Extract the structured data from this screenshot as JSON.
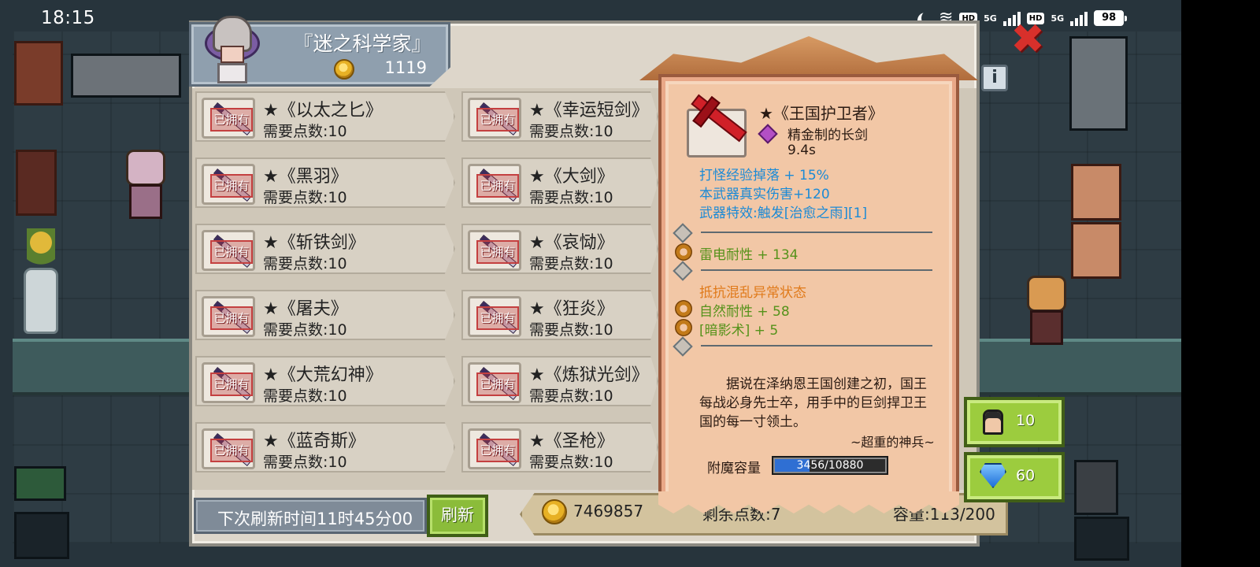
{
  "status_bar": {
    "time": "18:15",
    "hd1": "HD",
    "net1": "5G",
    "hd2": "HD",
    "net2": "5G",
    "battery": "98"
  },
  "header": {
    "merchant_name": "『迷之科学家』",
    "gold": "1119"
  },
  "owned_label": "已拥有",
  "items": [
    {
      "name": "★《以太之匕》",
      "cost": "需要点数:10"
    },
    {
      "name": "★《幸运短剑》",
      "cost": "需要点数:10"
    },
    {
      "name": "★《黑羽》",
      "cost": "需要点数:10"
    },
    {
      "name": "★《大剑》",
      "cost": "需要点数:10"
    },
    {
      "name": "★《斩铁剑》",
      "cost": "需要点数:10"
    },
    {
      "name": "★《哀恸》",
      "cost": "需要点数:10"
    },
    {
      "name": "★《屠夫》",
      "cost": "需要点数:10"
    },
    {
      "name": "★《狂炎》",
      "cost": "需要点数:10"
    },
    {
      "name": "★《大荒幻神》",
      "cost": "需要点数:10"
    },
    {
      "name": "★《炼狱光剑》",
      "cost": "需要点数:10"
    },
    {
      "name": "★《蓝奇斯》",
      "cost": "需要点数:10"
    },
    {
      "name": "★《圣枪》",
      "cost": "需要点数:10"
    }
  ],
  "footer": {
    "refresh_timer": "下次刷新时间11时45分00",
    "refresh_label": "刷新",
    "total_gold": "7469857",
    "points_left": "剩余点数:7",
    "capacity": "容量:113/200"
  },
  "tooltip": {
    "weapon_name": "★《王国护卫者》",
    "weapon_type": "精金制的长剑",
    "speed": "9.4s",
    "blue_stats": [
      "打怪经验掉落 + 15%",
      "本武器真实伤害+120",
      "武器特效:触发[治愈之雨][1]"
    ],
    "stat_thunder": "雷电耐性 + 134",
    "stat_confusion": "抵抗混乱异常状态",
    "stat_nature": "自然耐性 + 58",
    "stat_shadow": "[暗影术] + 5",
    "lore": "据说在泽纳恩王国创建之初，国王每战必身先士卒，用手中的巨剑捍卫王国的每一寸领土。",
    "lore_sign": "~超重的神兵~",
    "enchant_label": "附魔容量",
    "enchant_value": "3456/10880",
    "enchant_current": 3456,
    "enchant_max": 10880
  },
  "side": {
    "char_count": "10",
    "gem_count": "60",
    "info_label": "i",
    "close_label": "✖"
  },
  "colors": {
    "blue_stat": "#1b8ad6",
    "green_stat": "#55921a",
    "orange_stat": "#e07a1a",
    "accent_green_button": "#9ccc3e"
  }
}
